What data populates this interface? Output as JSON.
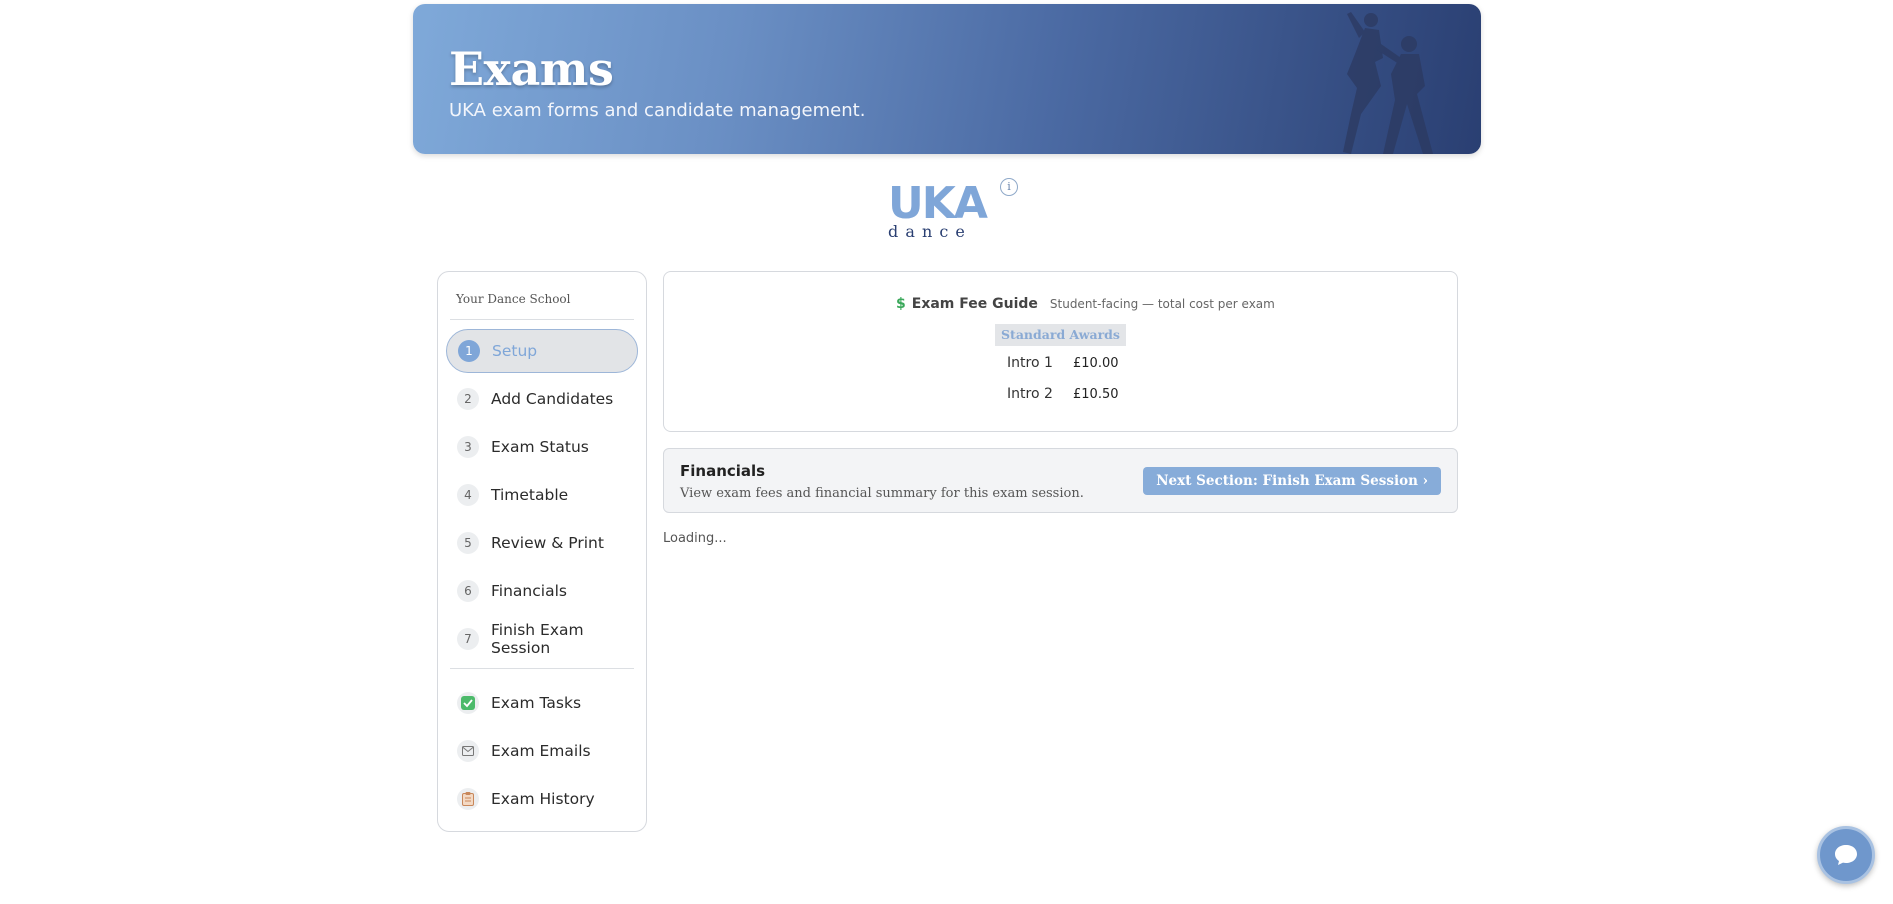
{
  "header": {
    "title": "Exams",
    "subtitle": "UKA exam forms and candidate management."
  },
  "logo": {
    "letters": "UKA",
    "subtext": "d a n c e",
    "info": "i"
  },
  "sidebar": {
    "school_name": "Your Dance School",
    "steps": [
      {
        "num": "1",
        "label": "Setup",
        "active": true
      },
      {
        "num": "2",
        "label": "Add Candidates"
      },
      {
        "num": "3",
        "label": "Exam Status"
      },
      {
        "num": "4",
        "label": "Timetable"
      },
      {
        "num": "5",
        "label": "Review & Print"
      },
      {
        "num": "6",
        "label": "Financials"
      },
      {
        "num": "7",
        "label": "Finish Exam Session"
      }
    ],
    "extras": [
      {
        "icon": "checkbox-icon",
        "label": "Exam Tasks"
      },
      {
        "icon": "mail-icon",
        "label": "Exam Emails"
      },
      {
        "icon": "clipboard-icon",
        "label": "Exam History"
      }
    ]
  },
  "fee_guide": {
    "icon": "dollar-icon",
    "title": "Exam Fee Guide",
    "note": "Student-facing — total cost per exam",
    "column_header": "Standard Awards",
    "rows": [
      {
        "name": "Intro 1",
        "price": "£10.00"
      },
      {
        "name": "Intro 2",
        "price": "£10.50"
      }
    ]
  },
  "financials": {
    "title": "Financials",
    "subtitle": "View exam fees and financial summary for this exam session.",
    "next_button": "Next Section: Finish Exam Session ›"
  },
  "status": {
    "loading": "Loading..."
  },
  "colors": {
    "accent": "#87acd9",
    "active_text": "#7fa6d8",
    "hero_dark": "#2a3f72"
  }
}
